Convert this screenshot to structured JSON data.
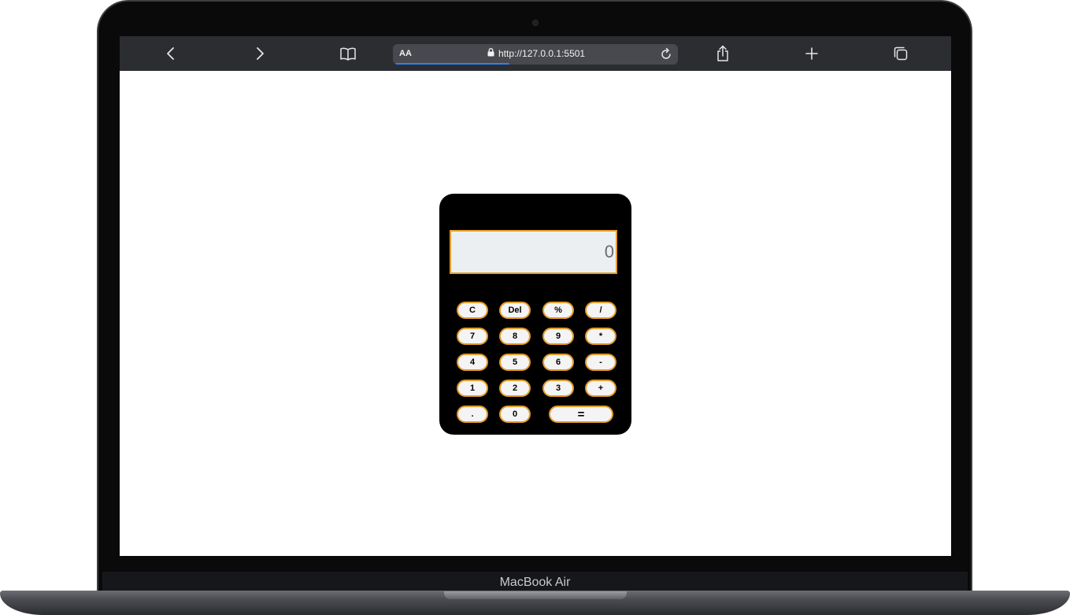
{
  "device": {
    "brand_label": "MacBook Air"
  },
  "browser": {
    "text_size_label": "AA",
    "url": "http://127.0.0.1:5501",
    "load_progress_percent": 40,
    "icons": {
      "back": "chevron-left-icon",
      "forward": "chevron-right-icon",
      "bookmarks": "book-icon",
      "lock": "lock-icon",
      "reload": "reload-icon",
      "share": "share-icon",
      "new_tab": "plus-icon",
      "tabs": "tabs-icon"
    }
  },
  "calculator": {
    "display_value": "0",
    "accent_color": "#e39a2a",
    "keys": {
      "clear": "C",
      "delete": "Del",
      "percent": "%",
      "divide": "/",
      "seven": "7",
      "eight": "8",
      "nine": "9",
      "multiply": "*",
      "four": "4",
      "five": "5",
      "six": "6",
      "subtract": "-",
      "one": "1",
      "two": "2",
      "three": "3",
      "add": "+",
      "decimal": ".",
      "zero": "0",
      "equals": "="
    }
  }
}
